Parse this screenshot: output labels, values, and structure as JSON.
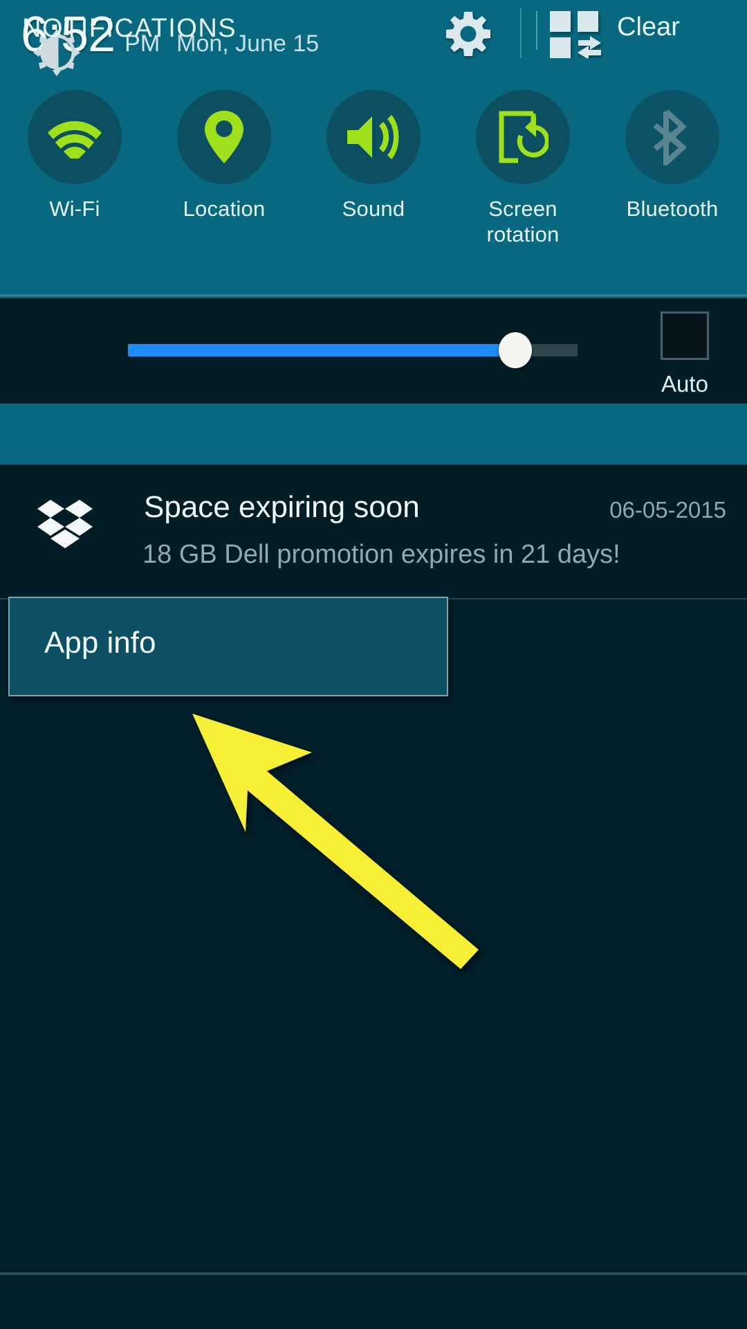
{
  "status_bar": {
    "time": "6:52",
    "ampm": "PM",
    "date": "Mon, June 15",
    "settings_icon": "gear-icon",
    "multiwindow_icon": "multi-window-icon"
  },
  "quick_settings": {
    "toggles": [
      {
        "label": "Wi-Fi",
        "icon": "wifi-icon",
        "active": true
      },
      {
        "label": "Location",
        "icon": "location-pin-icon",
        "active": true
      },
      {
        "label": "Sound",
        "icon": "speaker-volume-icon",
        "active": true
      },
      {
        "label": "Screen\nrotation",
        "label_line1": "Screen",
        "label_line2": "rotation",
        "icon": "screen-rotation-icon",
        "active": true
      },
      {
        "label": "Bluetooth",
        "icon": "bluetooth-icon",
        "active": false
      }
    ],
    "active_color": "#9fe01c",
    "inactive_color": "#5b8491",
    "circle_color": "#0b4f61",
    "panel_color": "#07687f"
  },
  "brightness": {
    "icon": "brightness-gear-icon",
    "value_percent": 86,
    "fill_color": "#1e8dfa",
    "auto_label": "Auto",
    "auto_checked": false
  },
  "notifications_header": {
    "title": "NOTIFICATIONS",
    "clear_label": "Clear"
  },
  "notification": {
    "app_icon": "dropbox-icon",
    "title": "Space expiring soon",
    "timestamp": "06-05-2015",
    "body": "18 GB Dell promotion expires in 21 days!"
  },
  "popup": {
    "app_info_label": "App info"
  },
  "annotation": {
    "arrow_color": "#f7ef35",
    "arrow_name": "pointer-arrow-annotation"
  }
}
